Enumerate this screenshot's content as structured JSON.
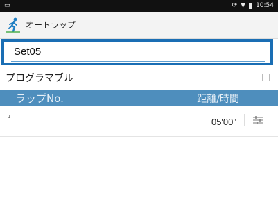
{
  "status_bar": {
    "time": "10:54"
  },
  "app_bar": {
    "title": "オートラップ",
    "icon": "runner-icon"
  },
  "name_field": {
    "value": "Set05"
  },
  "programmable": {
    "label": "プログラマブル",
    "checked": false
  },
  "table": {
    "headers": {
      "lap_no": "ラップNo.",
      "distance_time": "距離/時間"
    },
    "rows": [
      {
        "num": "1",
        "value": "05'00\""
      }
    ]
  },
  "colors": {
    "accent": "#1a6eb4",
    "header_bg": "#4e8ebd",
    "status_bar_bg": "#111111"
  }
}
